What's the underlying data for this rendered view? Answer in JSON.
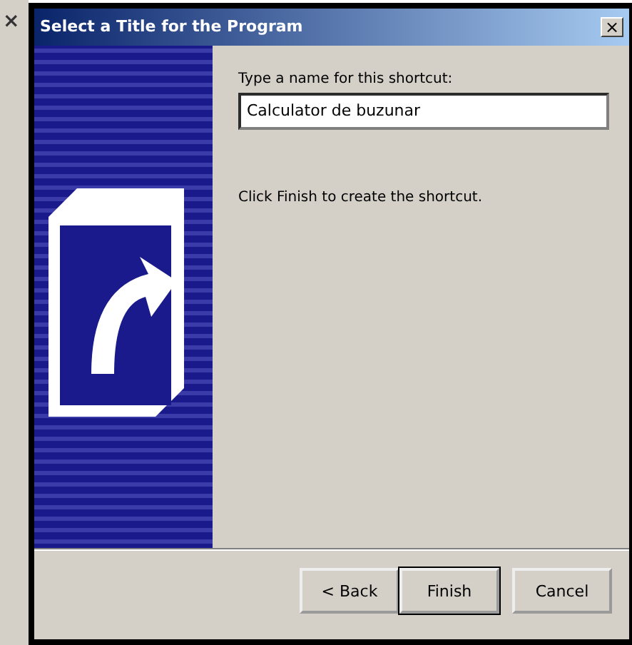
{
  "background_window": {
    "close_glyph": "×"
  },
  "dialog": {
    "title": "Select a Title for the Program",
    "close_glyph": "×",
    "field": {
      "label": "Type a name for this shortcut:",
      "value": "Calculator de buzunar"
    },
    "instruction": "Click Finish to create the shortcut.",
    "buttons": [
      {
        "label": "< Back",
        "default": false
      },
      {
        "label": "Finish",
        "default": true
      },
      {
        "label": "Cancel",
        "default": false
      }
    ]
  }
}
